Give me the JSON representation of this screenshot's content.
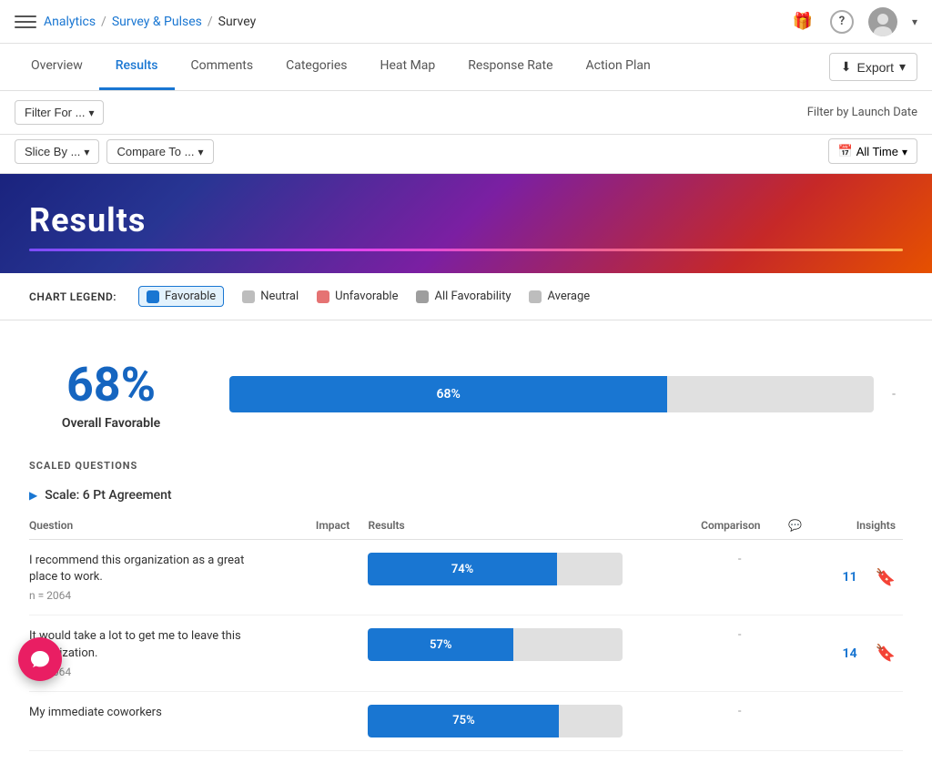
{
  "header": {
    "breadcrumb": {
      "root": "Analytics",
      "parent": "Survey & Pulses",
      "current": "Survey"
    },
    "icons": {
      "gift": "🎁",
      "help": "?",
      "user": "👤"
    }
  },
  "nav": {
    "tabs": [
      {
        "id": "overview",
        "label": "Overview",
        "active": false
      },
      {
        "id": "results",
        "label": "Results",
        "active": true
      },
      {
        "id": "comments",
        "label": "Comments",
        "active": false
      },
      {
        "id": "categories",
        "label": "Categories",
        "active": false
      },
      {
        "id": "heat-map",
        "label": "Heat Map",
        "active": false
      },
      {
        "id": "response-rate",
        "label": "Response Rate",
        "active": false
      },
      {
        "id": "action-plan",
        "label": "Action Plan",
        "active": false
      }
    ],
    "export_label": "Export"
  },
  "filters": {
    "filter_for_label": "Filter For ...",
    "slice_by_label": "Slice By ...",
    "compare_to_label": "Compare To ...",
    "filter_by_launch_date": "Filter by Launch Date",
    "all_time_label": "All Time"
  },
  "results_banner": {
    "title": "Results"
  },
  "legend": {
    "chart_legend_label": "CHART LEGEND:",
    "items": [
      {
        "id": "favorable",
        "label": "Favorable",
        "color": "#1976d2",
        "selected": true
      },
      {
        "id": "neutral",
        "label": "Neutral",
        "color": "#bdbdbd",
        "selected": false
      },
      {
        "id": "unfavorable",
        "label": "Unfavorable",
        "color": "#e57373",
        "selected": false
      },
      {
        "id": "all-favorability",
        "label": "All Favorability",
        "color": "#9e9e9e",
        "selected": false
      },
      {
        "id": "average",
        "label": "Average",
        "color": "#bdbdbd",
        "selected": false
      }
    ]
  },
  "overall": {
    "percentage": "68%",
    "label": "Overall Favorable",
    "bar_fill_pct": 68,
    "comparison_dash": "-"
  },
  "scaled_questions": {
    "section_label": "SCALED QUESTIONS",
    "scale_group": {
      "label": "Scale: 6 Pt Agreement"
    },
    "columns": {
      "question": "Question",
      "impact": "Impact",
      "results": "Results",
      "comparison": "Comparison",
      "chat_icon": "💬",
      "insights": "Insights"
    },
    "rows": [
      {
        "question": "I recommend this organization as a great place to work.",
        "n": "n = 2064",
        "impact": "",
        "bar_pct": 74,
        "bar_label": "74%",
        "comparison": "-",
        "insights_count": "11",
        "bookmarked": false
      },
      {
        "question": "It would take a lot to get me to leave this organization.",
        "n": "n = 2064",
        "impact": "",
        "bar_pct": 57,
        "bar_label": "57%",
        "comparison": "-",
        "insights_count": "14",
        "bookmarked": false
      },
      {
        "question": "My immediate coworkers",
        "n": "",
        "impact": "",
        "bar_pct": 75,
        "bar_label": "75%",
        "comparison": "-",
        "insights_count": "",
        "bookmarked": false
      }
    ]
  }
}
